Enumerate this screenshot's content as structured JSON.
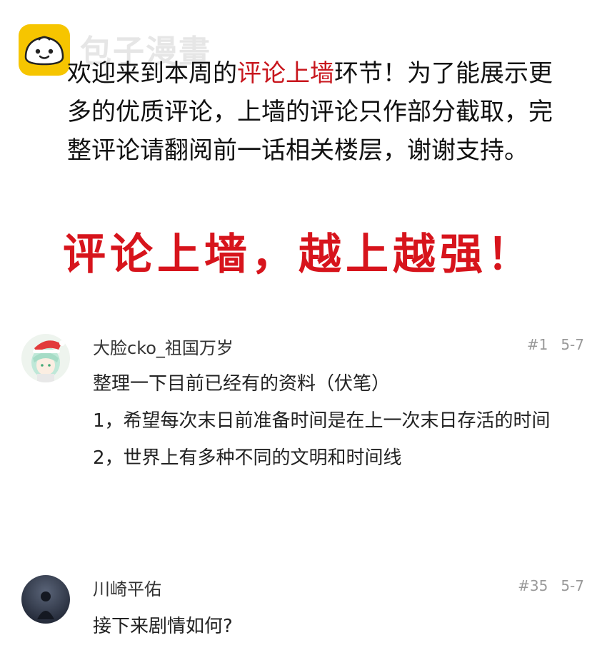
{
  "watermark": "包子漫畫",
  "intro": {
    "before": "欢迎来到本周的",
    "highlight": "评论上墙",
    "after": "环节！为了能展示更多的优质评论，上墙的评论只作部分截取，完整评论请翻阅前一话相关楼层，谢谢支持。"
  },
  "slogan": "评论上墙，越上越强！",
  "comments": [
    {
      "username": "大脸cko_祖国万岁",
      "floor": "#1",
      "date": "5-7",
      "lines": [
        "整理一下目前已经有的资料（伏笔）",
        "1，希望每次末日前准备时间是在上一次末日存活的时间",
        "2，世界上有多种不同的文明和时间线"
      ]
    },
    {
      "username": "川崎平佑",
      "floor": "#35",
      "date": "5-7",
      "lines": [
        "接下来剧情如何?"
      ]
    }
  ],
  "colors": {
    "accent_red": "#d7141c",
    "logo_yellow": "#f6c500"
  },
  "icons": {
    "logo": "bun-logo-icon",
    "avatar1": "anime-avatar-santa-hat",
    "avatar2": "dark-photo-avatar"
  }
}
